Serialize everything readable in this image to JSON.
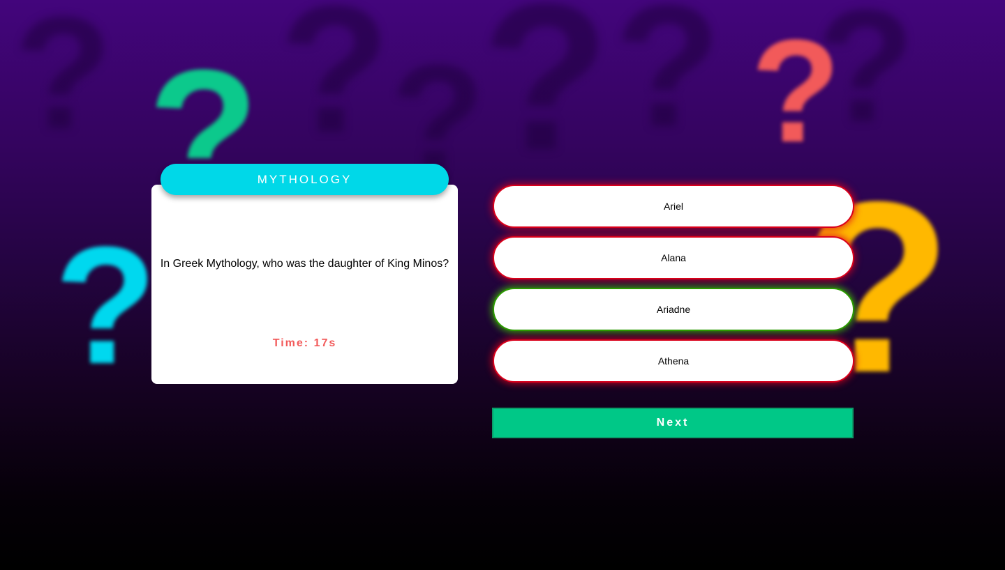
{
  "category": "MYTHOLOGY",
  "question": "In Greek Mythology, who was the daughter of King Minos?",
  "timer": "Time: 17s",
  "answers": [
    {
      "label": "Ariel",
      "state": "wrong"
    },
    {
      "label": "Alana",
      "state": "wrong"
    },
    {
      "label": "Ariadne",
      "state": "correct"
    },
    {
      "label": "Athena",
      "state": "wrong"
    }
  ],
  "next_label": "Next",
  "background": {
    "decoration": "question-mark-icons",
    "colors": {
      "green": "#0cc98c",
      "red": "#f25a5a",
      "cyan": "#00d8ef",
      "yellow": "#ffb800"
    }
  },
  "colors": {
    "category_pill": "#00d8e8",
    "timer": "#f25a5a",
    "wrong_border": "#d9001b",
    "correct_border": "#2b9a00",
    "next_button": "#00c887"
  }
}
